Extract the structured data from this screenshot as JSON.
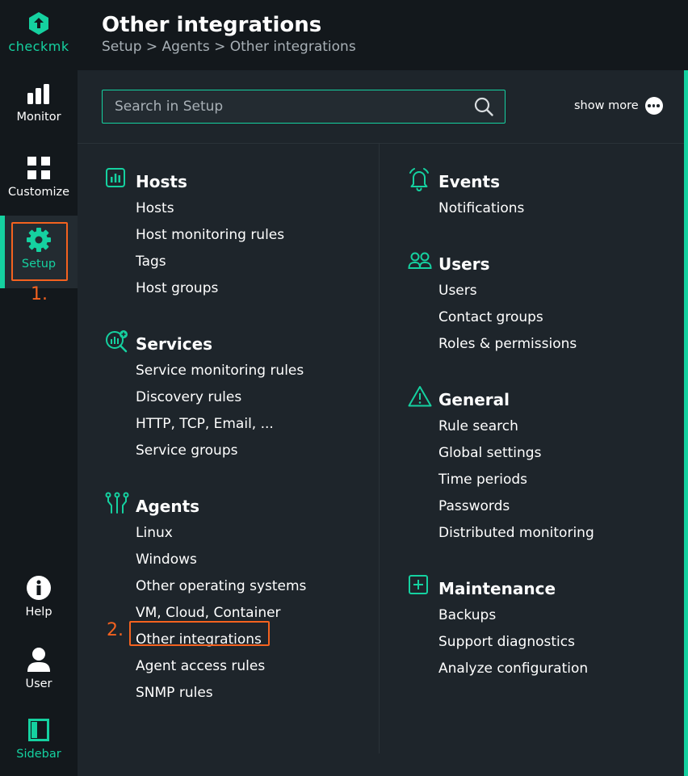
{
  "app": {
    "logo_text_a": "check",
    "logo_text_b": "mk",
    "accent": "#15d1a0",
    "highlight": "#f4621f"
  },
  "nav": {
    "monitor": "Monitor",
    "customize": "Customize",
    "setup": "Setup",
    "help": "Help",
    "user": "User",
    "sidebar": "Sidebar",
    "step1": "1."
  },
  "header": {
    "title": "Other integrations",
    "breadcrumb": "Setup > Agents > Other integrations"
  },
  "search": {
    "placeholder": "Search in Setup",
    "show_more": "show more"
  },
  "sections": {
    "hosts": {
      "title": "Hosts",
      "icon": "hosts-icon",
      "items": [
        "Hosts",
        "Host monitoring rules",
        "Tags",
        "Host groups"
      ]
    },
    "services": {
      "title": "Services",
      "icon": "services-icon",
      "items": [
        "Service monitoring rules",
        "Discovery rules",
        "HTTP, TCP, Email, ...",
        "Service groups"
      ]
    },
    "agents": {
      "title": "Agents",
      "icon": "agents-icon",
      "items": [
        "Linux",
        "Windows",
        "Other operating systems",
        "VM, Cloud, Container",
        "Other integrations",
        "Agent access rules",
        "SNMP rules"
      ],
      "step2": "2."
    },
    "events": {
      "title": "Events",
      "icon": "bell-icon",
      "items": [
        "Notifications"
      ]
    },
    "users": {
      "title": "Users",
      "icon": "users-icon",
      "items": [
        "Users",
        "Contact groups",
        "Roles & permissions"
      ]
    },
    "general": {
      "title": "General",
      "icon": "warning-icon",
      "items": [
        "Rule search",
        "Global settings",
        "Time periods",
        "Passwords",
        "Distributed monitoring"
      ]
    },
    "maintenance": {
      "title": "Maintenance",
      "icon": "plus-box-icon",
      "items": [
        "Backups",
        "Support diagnostics",
        "Analyze configuration"
      ]
    }
  }
}
